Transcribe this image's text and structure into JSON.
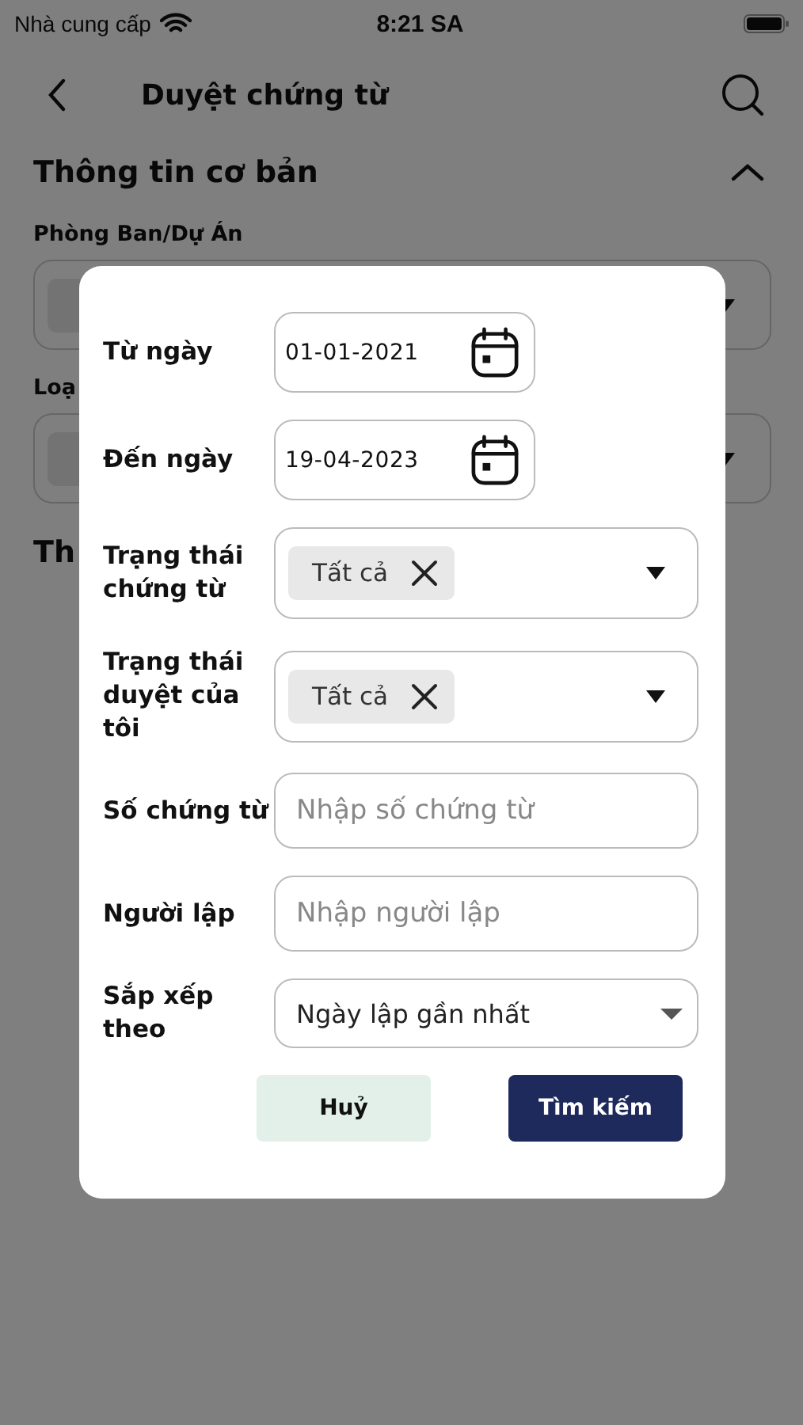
{
  "status_bar": {
    "carrier": "Nhà cung cấp",
    "time": "8:21 SA"
  },
  "header": {
    "title": "Duyệt chứng từ"
  },
  "section": {
    "title": "Thông tin cơ bản",
    "expanded": true
  },
  "background_fields": [
    {
      "label": "Phòng Ban/Dự Án"
    },
    {
      "label": "Loạ"
    }
  ],
  "next_section": {
    "title": "Th"
  },
  "dialog": {
    "filters": [
      {
        "kind": "date",
        "label": "Từ ngày",
        "value": "01-01-2021"
      },
      {
        "kind": "date",
        "label": "Đến ngày",
        "value": "19-04-2023"
      },
      {
        "kind": "multiselect",
        "label": "Trạng thái\nchứng từ",
        "chip": "Tất cả"
      },
      {
        "kind": "multiselect",
        "label": "Trạng thái\nduyệt của\ntôi",
        "chip": "Tất cả"
      },
      {
        "kind": "text",
        "label": "Số chứng từ",
        "placeholder": "Nhập số chứng từ"
      },
      {
        "kind": "text",
        "label": "Người lập",
        "placeholder": "Nhập người lập"
      },
      {
        "kind": "select",
        "label": "Sắp xếp\ntheo",
        "value": "Ngày lập gần nhất"
      }
    ],
    "buttons": [
      {
        "kind": "secondary",
        "label": "Huỷ"
      },
      {
        "kind": "primary",
        "label": "Tìm kiếm"
      }
    ]
  }
}
